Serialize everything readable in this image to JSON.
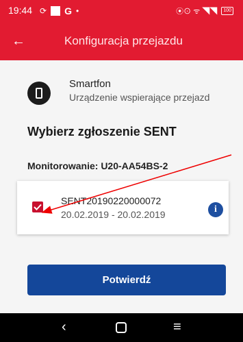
{
  "status_bar": {
    "time": "19:44",
    "g_label": "G",
    "dot": "•",
    "right_text": "⦿⊙ ᯤ ◥◥",
    "battery": "100"
  },
  "app_bar": {
    "back_icon": "←",
    "title": "Konfiguracja przejazdu"
  },
  "device": {
    "title": "Smartfon",
    "subtitle": "Urządzenie wspierające przejazd"
  },
  "section_heading": "Wybierz zgłoszenie SENT",
  "monitoring_label": "Monitorowanie: U20-AA54BS-2",
  "entry": {
    "number": "SENT20190220000072",
    "dates": "20.02.2019 - 20.02.2019",
    "checked": true,
    "info_icon": "i"
  },
  "confirm_button": "Potwierdź",
  "nav_bar": {
    "back": "‹",
    "menu": "≡"
  },
  "colors": {
    "brand_red": "#e21b31",
    "checkbox_red": "#c8102e",
    "button_blue": "#14479a",
    "info_blue": "#1e4fa0"
  }
}
